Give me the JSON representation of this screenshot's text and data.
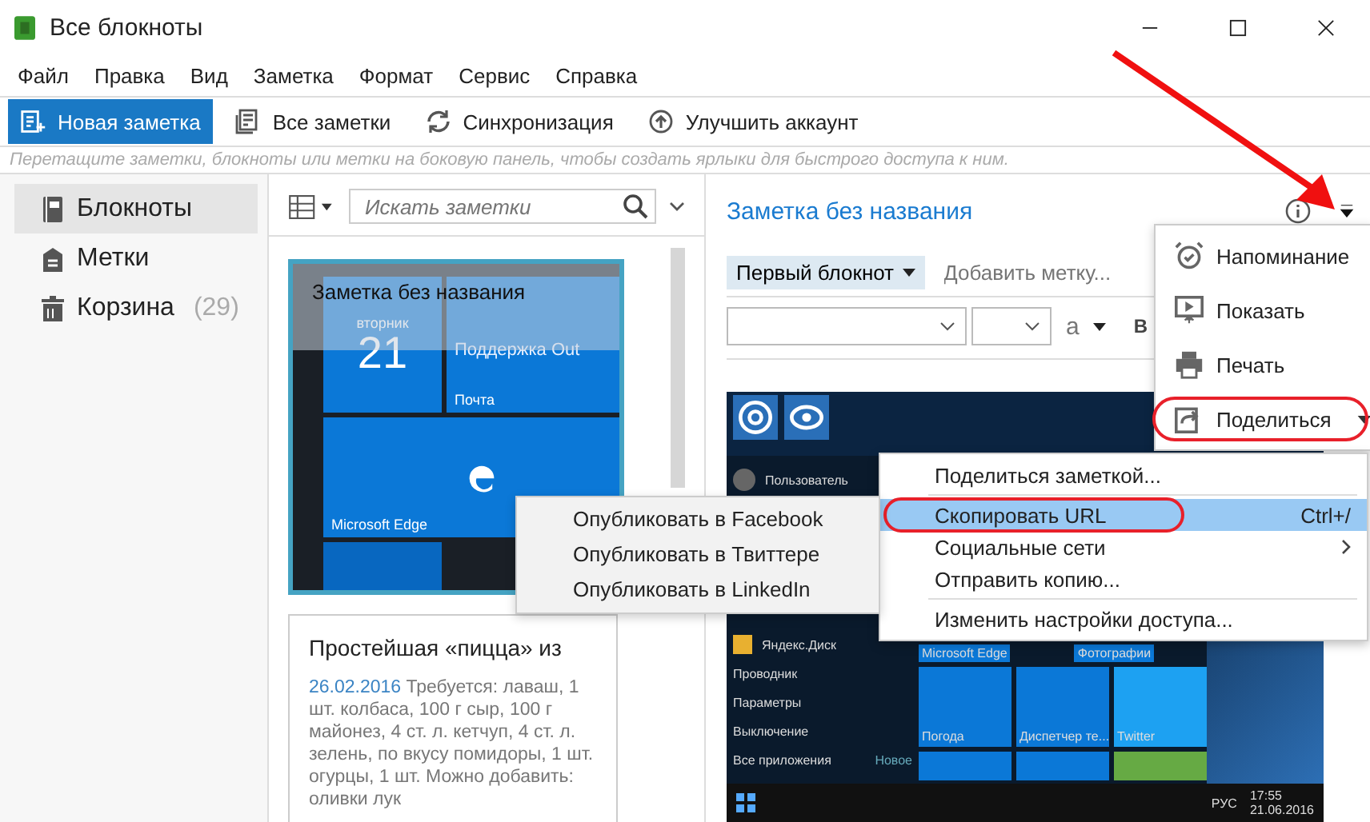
{
  "window": {
    "title": "Все блокноты"
  },
  "menu": [
    "Файл",
    "Правка",
    "Вид",
    "Заметка",
    "Формат",
    "Сервис",
    "Справка"
  ],
  "toolbar": [
    {
      "label": "Новая заметка",
      "kind": "new"
    },
    {
      "label": "Все заметки",
      "kind": "all"
    },
    {
      "label": "Синхронизация",
      "kind": "sync"
    },
    {
      "label": "Улучшить аккаунт",
      "kind": "upgrade"
    }
  ],
  "hint": "Перетащите заметки, блокноты или метки на боковую панель, чтобы создать ярлыки для быстрого доступа к ним.",
  "sidebar": {
    "items": [
      {
        "label": "Блокноты",
        "kind": "notebooks",
        "selected": true
      },
      {
        "label": "Метки",
        "kind": "tags",
        "selected": false
      },
      {
        "label": "Корзина",
        "count": "(29)",
        "kind": "trash",
        "selected": false
      }
    ]
  },
  "note_list": {
    "search": {
      "placeholder": "Искать заметки"
    },
    "thumbnail": {
      "title": "Заметка без названия",
      "selected": true,
      "tiles": [
        "вторник",
        "21",
        "Поддержка Out",
        "Почта",
        "Microsoft Edge"
      ]
    },
    "notes": [
      {
        "title": "Простейшая «пицца» из",
        "date": "26.02.2016",
        "snippet": "Требуется: лаваш, 1 шт. колбаса, 100 г сыр, 100 г майонез, 4 ст. л. кетчуп, 4 ст. л. зелень, по вкусу помидоры, 1 шт. огурцы, 1 шт. Можно добавить: оливки лук",
        "selected": false
      }
    ]
  },
  "editor": {
    "title": "Заметка без названия",
    "notebook": "Первый блокнот",
    "tag_placeholder": "Добавить метку...",
    "font_color": "a",
    "bold": "B",
    "image": {
      "user": "Пользователь",
      "apps": [
        "Яндекс.Диск"
      ],
      "places": [
        "Проводник",
        "Параметры",
        "Выключение",
        "Все приложения"
      ],
      "new_label": "Новое",
      "tile_labels": [
        "Microsoft Edge",
        "Фотографии"
      ],
      "tiles": [
        "Погода",
        "Диспетчер те...",
        "Twitter"
      ],
      "lang": "РУС",
      "time": "17:55",
      "date": "21.06.2016"
    }
  },
  "more_menu": {
    "items": [
      {
        "label": "Напоминание",
        "kind": "reminder",
        "circled": false
      },
      {
        "label": "Показать",
        "kind": "present",
        "circled": false
      },
      {
        "label": "Печать",
        "kind": "print",
        "circled": false
      },
      {
        "label": "Поделиться",
        "kind": "share",
        "circled": true
      }
    ]
  },
  "share_menu": {
    "items": [
      {
        "label": "Поделиться заметкой...",
        "submenu": false,
        "selected": false,
        "circled": false
      },
      {
        "label": "Скопировать URL",
        "shortcut": "Ctrl+/",
        "submenu": false,
        "selected": true,
        "circled": true
      },
      {
        "label": "Социальные сети",
        "submenu": true,
        "selected": false,
        "circled": false
      },
      {
        "label": "Отправить копию...",
        "submenu": false,
        "selected": false,
        "circled": false
      },
      {
        "label": "Изменить настройки доступа...",
        "submenu": false,
        "selected": false,
        "circled": false
      }
    ]
  },
  "social_menu": {
    "items": [
      {
        "label": "Опубликовать в Facebook"
      },
      {
        "label": "Опубликовать в Твиттере"
      },
      {
        "label": "Опубликовать в LinkedIn"
      }
    ]
  }
}
